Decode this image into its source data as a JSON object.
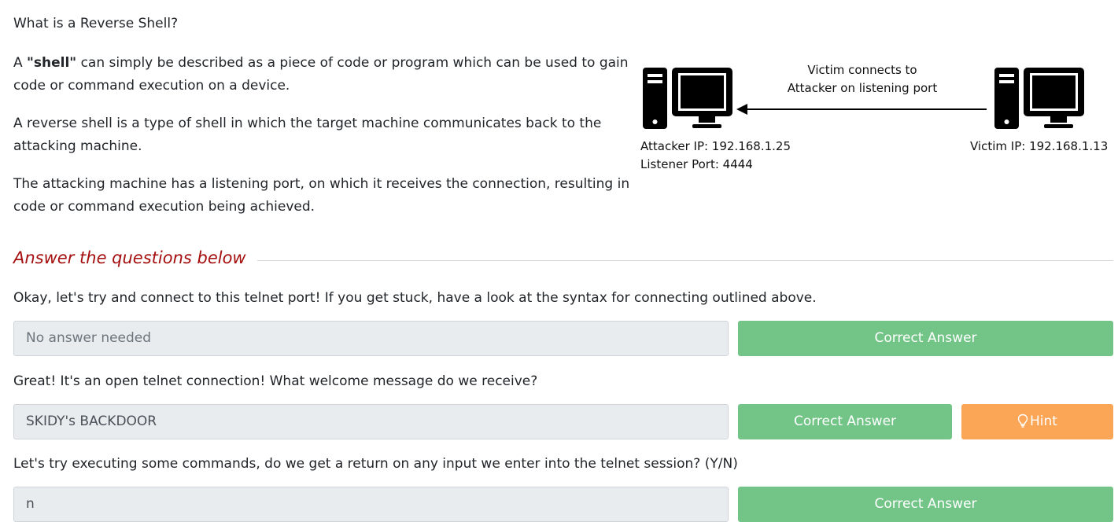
{
  "intro": {
    "heading": "What is a Reverse Shell?",
    "p1_prefix": "A ",
    "p1_bold": "\"shell\"",
    "p1_suffix": " can simply be described as a piece of code or program which can be used to gain code or command execution on a device.",
    "p2": "A reverse shell is a type of shell in which the target machine communicates back to the attacking machine.",
    "p3": "The attacking machine has a listening port, on which it receives the connection, resulting in code or command execution being achieved."
  },
  "diagram": {
    "arrow_label_line1": "Victim connects to",
    "arrow_label_line2": "Attacker on listening port",
    "attacker_ip": "Attacker IP: 192.168.1.25",
    "listener_port": "Listener Port: 4444",
    "victim_ip": "Victim IP: 192.168.1.13"
  },
  "section": {
    "title": "Answer the questions below"
  },
  "questions": [
    {
      "text": "Okay, let's try and connect to this telnet port! If you get stuck, have a look at the syntax for connecting outlined above.",
      "answer": "No answer needed",
      "button": "Correct Answer"
    },
    {
      "text": "Great! It's an open telnet connection! What welcome message do we receive?",
      "answer": "SKIDY's BACKDOOR",
      "button": "Correct Answer",
      "hint": "Hint"
    },
    {
      "text": "Let's try executing some commands, do we get a return on any input we enter into the telnet session? (Y/N)",
      "answer": "n",
      "button": "Correct Answer"
    }
  ],
  "icons": {
    "attacker_computer": "desktop-computer-icon",
    "victim_computer": "desktop-computer-icon",
    "hint": "lightbulb-icon"
  },
  "colors": {
    "section_title": "#a50e0e",
    "correct_button": "#72c587",
    "hint_button": "#fba657",
    "input_bg": "#e9ecef"
  }
}
